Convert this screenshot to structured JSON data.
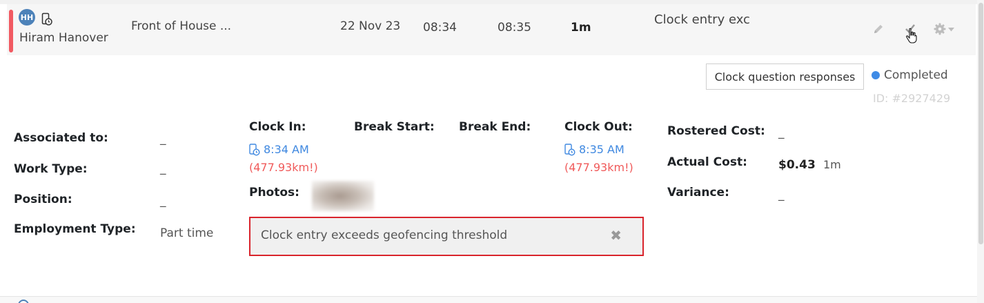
{
  "summary": {
    "avatar_initials": "HH",
    "employee_name": "Hiram Hanover",
    "area": "Front of House ...",
    "date": "22 Nov 23",
    "start_time": "08:34",
    "end_time": "08:35",
    "duration": "1m",
    "notes": "Clock entry exc",
    "status_color": "#f15a62",
    "icons": [
      "phone-clock-icon",
      "pencil-icon",
      "checkmark-icon",
      "gear-icon",
      "caret-down-icon"
    ]
  },
  "actions": {
    "responses_button": "Clock question responses"
  },
  "status": {
    "label": "Completed",
    "dot_color": "#3f8be6",
    "entry_id": "ID: #2927429"
  },
  "details": {
    "associated_to": {
      "label": "Associated to:",
      "value": "_"
    },
    "work_type": {
      "label": "Work Type:",
      "value": "_"
    },
    "position": {
      "label": "Position:",
      "value": "_"
    },
    "employment_type": {
      "label": "Employment Type:",
      "value": "Part time"
    }
  },
  "clock": {
    "clock_in": {
      "label": "Clock In:",
      "time": "8:34 AM",
      "distance": "(477.93km!)"
    },
    "break_start": {
      "label": "Break Start:"
    },
    "break_end": {
      "label": "Break End:"
    },
    "clock_out": {
      "label": "Clock Out:",
      "time": "8:35 AM",
      "distance": "(477.93km!)"
    },
    "photos_label": "Photos:"
  },
  "warning": {
    "message": "Clock entry exceeds geofencing threshold",
    "dismiss": "✖",
    "border_color": "#d9242c"
  },
  "costs": {
    "rostered": {
      "label": "Rostered Cost:",
      "value": "_"
    },
    "actual": {
      "label": "Actual Cost:",
      "value": "$0.43",
      "duration": "1m"
    },
    "variance": {
      "label": "Variance:",
      "value": "_"
    }
  }
}
